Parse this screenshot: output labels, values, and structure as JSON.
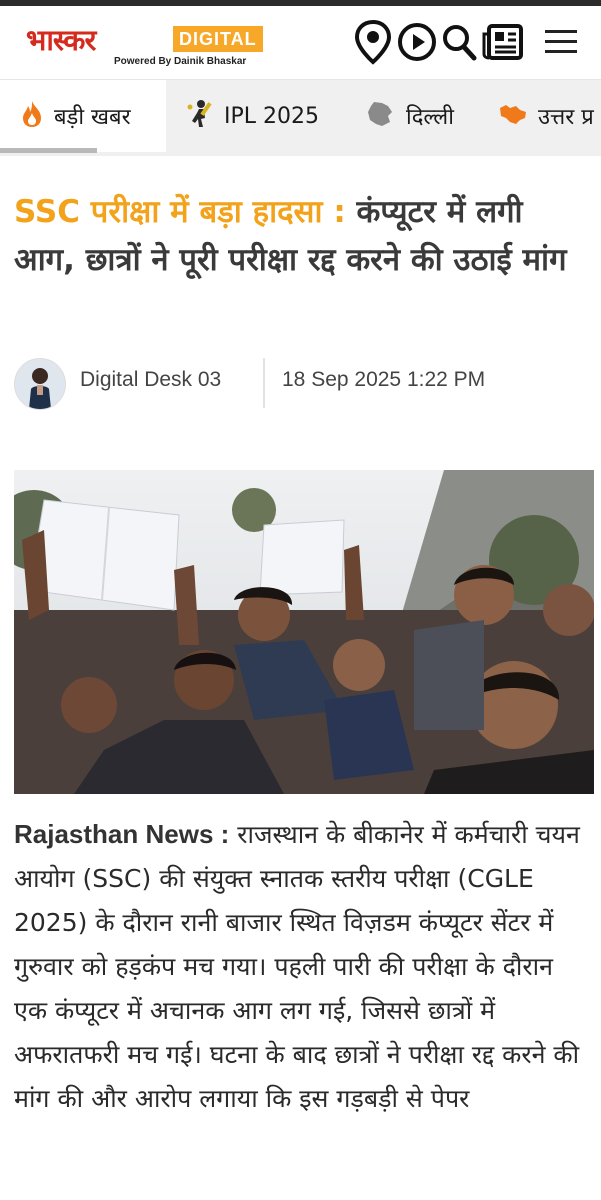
{
  "header": {
    "logo_hindi": "भास्कर",
    "logo_digital": "DIGITAL",
    "logo_powered": "Powered By Dainik Bhaskar",
    "icons": [
      "location-pin-icon",
      "play-icon",
      "search-icon",
      "newspaper-icon",
      "hamburger-menu-icon"
    ]
  },
  "tabs": [
    {
      "label": "बड़ी खबर",
      "icon": "flame-icon",
      "active": true
    },
    {
      "label": "IPL 2025",
      "icon": "cricket-batsman-icon"
    },
    {
      "label": "दिल्ली",
      "icon": "delhi-map-icon"
    },
    {
      "label": "उत्तर प्र",
      "icon": "up-map-icon"
    }
  ],
  "article": {
    "headline_prefix": "SSC परीक्षा में बड़ा हादसा :",
    "headline_main": "कंप्यूटर में लगी आग, छात्रों ने पूरी परीक्षा रद्द करने की उठाई मांग",
    "author": "Digital Desk 03",
    "date": "18 Sep 2025 1:22 PM",
    "lead": "Rajasthan News :",
    "body": "राजस्थान के बीकानेर में कर्मचारी चयन आयोग (SSC) की संयुक्त स्नातक स्तरीय परीक्षा (CGLE 2025) के दौरान रानी बाजार स्थित विज़डम कंप्यूटर सेंटर में गुरुवार को हड़कंप मच गया। पहली पारी की परीक्षा के दौरान एक कंप्यूटर में अचानक आग लग गई, जिससे छात्रों में अफरातफरी मच गई। घटना के बाद छात्रों ने परीक्षा रद्द करने की मांग की और आरोप लगाया कि इस गड़बड़ी से पेपर"
  },
  "colors": {
    "accent": "#f2a31b",
    "brand_red": "#d52b1e",
    "digital_orange": "#f7a828"
  }
}
